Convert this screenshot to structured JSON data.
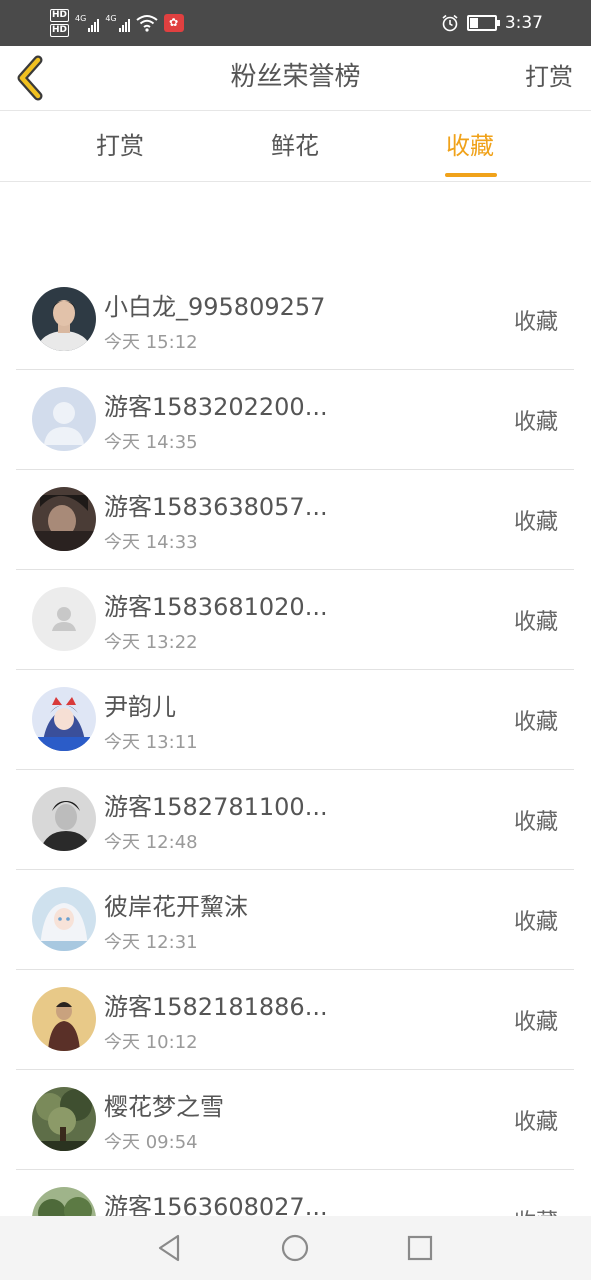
{
  "status_bar": {
    "hd1": "HD",
    "hd2": "HD",
    "net1": "4G",
    "net2": "4G",
    "time": "3:37",
    "battery_level": 0.35
  },
  "header": {
    "title": "粉丝荣誉榜",
    "right_action": "打赏"
  },
  "tabs": [
    {
      "label": "打赏",
      "active": false
    },
    {
      "label": "鲜花",
      "active": false
    },
    {
      "label": "收藏",
      "active": true
    }
  ],
  "accent_color": "#f0a21a",
  "list": [
    {
      "name": "小白龙_995809257",
      "time": "今天 15:12",
      "action": "收藏",
      "avatar": "photo-person-icon"
    },
    {
      "name": "游客1583202200...",
      "time": "今天 14:35",
      "action": "收藏",
      "avatar": "default-user-blue-icon"
    },
    {
      "name": "游客1583638057...",
      "time": "今天 14:33",
      "action": "收藏",
      "avatar": "photo-dark-portrait-icon"
    },
    {
      "name": "游客1583681020...",
      "time": "今天 13:22",
      "action": "收藏",
      "avatar": "default-user-gray-icon"
    },
    {
      "name": "尹韵儿",
      "time": "今天 13:11",
      "action": "收藏",
      "avatar": "anime-girl-icon"
    },
    {
      "name": "游客1582781100...",
      "time": "今天 12:48",
      "action": "收藏",
      "avatar": "photo-bw-portrait-icon"
    },
    {
      "name": "彼岸花开黧沫",
      "time": "今天 12:31",
      "action": "收藏",
      "avatar": "anime-white-hair-icon"
    },
    {
      "name": "游客1582181886...",
      "time": "今天 10:12",
      "action": "收藏",
      "avatar": "photo-yellow-portrait-icon"
    },
    {
      "name": "樱花梦之雪",
      "time": "今天 09:54",
      "action": "收藏",
      "avatar": "photo-tree-icon"
    },
    {
      "name": "游客1563608027...",
      "time": "",
      "action": "收藏",
      "avatar": "photo-landscape-icon"
    }
  ]
}
